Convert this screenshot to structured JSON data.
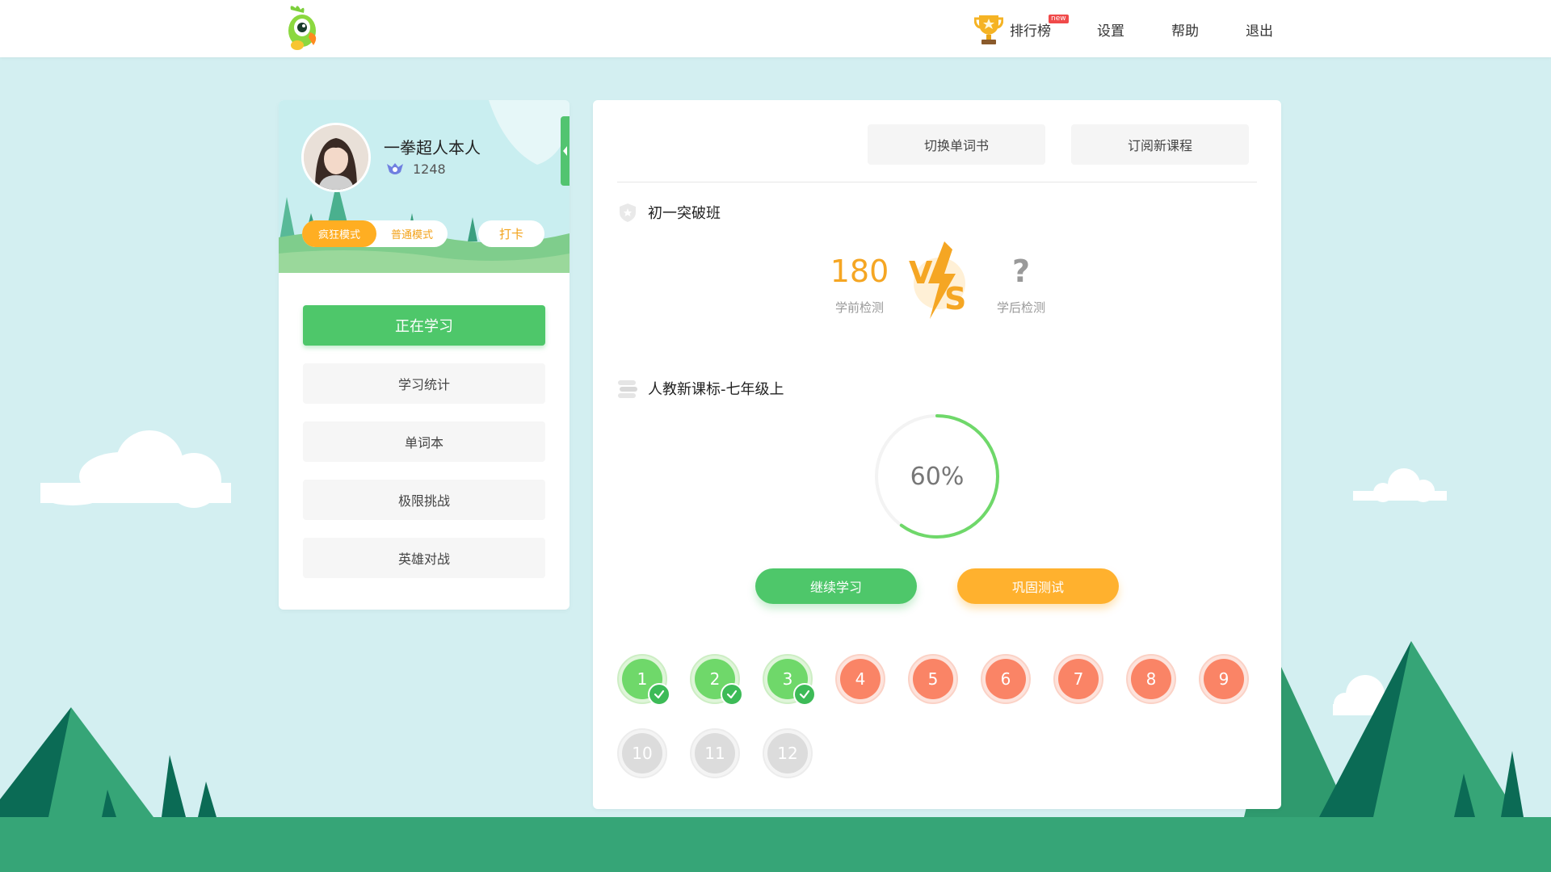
{
  "topbar": {
    "nav": {
      "rank_label": "排行榜",
      "rank_badge": "new",
      "settings_label": "设置",
      "help_label": "帮助",
      "logout_label": "退出"
    }
  },
  "profile": {
    "username": "一拳超人本人",
    "score": "1248",
    "mode_crazy": "疯狂模式",
    "mode_normal": "普通模式",
    "selected_mode": "疯狂模式",
    "checkin_label": "打卡"
  },
  "menu": {
    "items": [
      {
        "label": "正在学习",
        "active": true
      },
      {
        "label": "学习统计",
        "active": false
      },
      {
        "label": "单词本",
        "active": false
      },
      {
        "label": "极限挑战",
        "active": false
      },
      {
        "label": "英雄对战",
        "active": false
      }
    ]
  },
  "main": {
    "switch_book_label": "切换单词书",
    "subscribe_label": "订阅新课程",
    "class_title": "初一突破班",
    "pre_test": {
      "value": "180",
      "label": "学前检测"
    },
    "post_test": {
      "value": "?",
      "label": "学后检测"
    },
    "vs_text": "VS",
    "course_title": "人教新课标-七年级上",
    "progress": {
      "percent": 60,
      "text": "60%"
    },
    "continue_label": "继续学习",
    "consolidate_label": "巩固测试",
    "units": [
      {
        "number": "1",
        "status": "done"
      },
      {
        "number": "2",
        "status": "done"
      },
      {
        "number": "3",
        "status": "done"
      },
      {
        "number": "4",
        "status": "todo"
      },
      {
        "number": "5",
        "status": "todo"
      },
      {
        "number": "6",
        "status": "todo"
      },
      {
        "number": "7",
        "status": "todo"
      },
      {
        "number": "8",
        "status": "todo"
      },
      {
        "number": "9",
        "status": "todo"
      },
      {
        "number": "10",
        "status": "locked"
      },
      {
        "number": "11",
        "status": "locked"
      },
      {
        "number": "12",
        "status": "locked"
      }
    ]
  },
  "colors": {
    "background": "#d3eff1",
    "accent_green": "#4ec76a",
    "accent_orange": "#ffb12e",
    "unit_todo": "#fa8466",
    "ground": "#36a577"
  }
}
